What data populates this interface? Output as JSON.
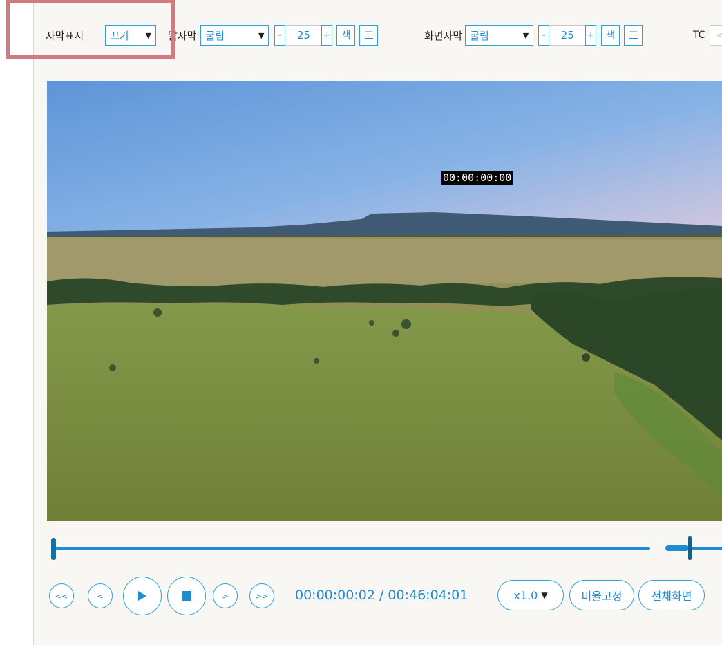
{
  "toolbar": {
    "subtitle_display": {
      "label": "자막표시",
      "value": "끄기"
    },
    "speech_subtitle": {
      "label": "말자막",
      "font": "굴림",
      "minus": "-",
      "size": "25",
      "plus": "+",
      "color_button": "색",
      "align_button": "三"
    },
    "screen_subtitle": {
      "label": "화면자막",
      "font": "굴림",
      "minus": "-",
      "size": "25",
      "plus": "+",
      "color_button": "색",
      "align_button": "三"
    },
    "tc": {
      "label": "TC",
      "value": "<"
    }
  },
  "video": {
    "timecode_overlay": "00:00:00:00"
  },
  "seek": {
    "position_fraction": 0.0
  },
  "controls": {
    "rewind_fast": "<<",
    "rewind": "<",
    "forward": ">",
    "forward_fast": ">>",
    "current_time": "00:00:00:02",
    "separator": "/",
    "total_time": "00:46:04:01",
    "speed": "x1.0",
    "aspect_lock": "비율고정",
    "fullscreen": "전체화면"
  },
  "colors": {
    "accent": "#1f8bd0",
    "highlight": "#cf7b80"
  }
}
